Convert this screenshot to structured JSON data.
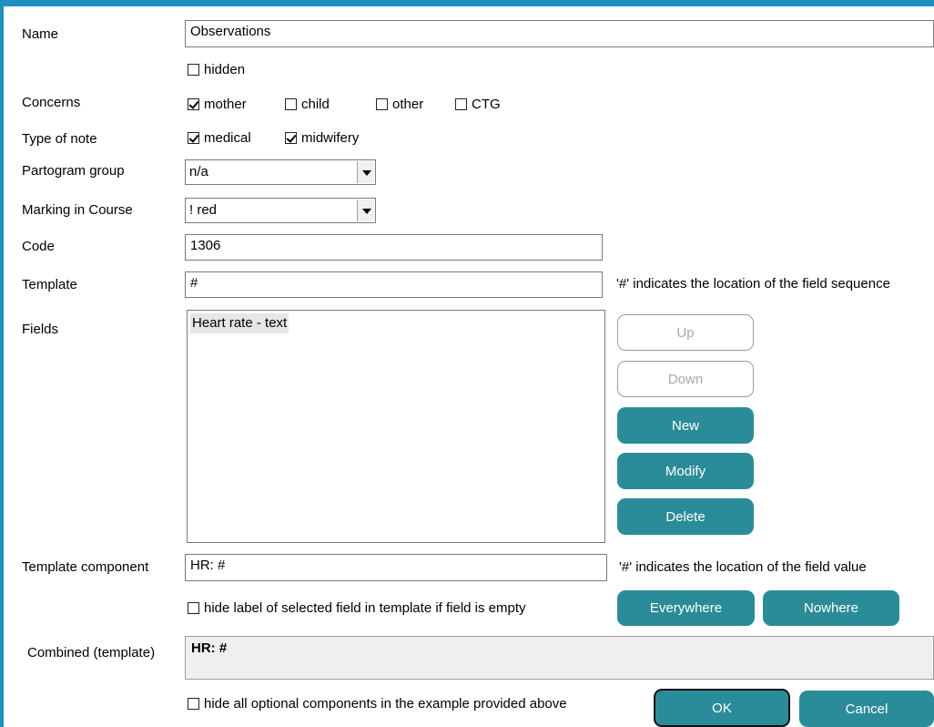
{
  "labels": {
    "name": "Name",
    "concerns": "Concerns",
    "type_of_note": "Type of note",
    "partogram_group": "Partogram group",
    "marking_in_course": "Marking in Course",
    "code": "Code",
    "template": "Template",
    "fields": "Fields",
    "template_component": "Template  component",
    "combined": "Combined (template)"
  },
  "name_value": "Observations",
  "hidden": {
    "label": "hidden",
    "checked": false
  },
  "concerns": [
    {
      "label": "mother",
      "checked": true
    },
    {
      "label": "child",
      "checked": false
    },
    {
      "label": "other",
      "checked": false
    },
    {
      "label": "CTG",
      "checked": false
    }
  ],
  "type_of_note": [
    {
      "label": "medical",
      "checked": true
    },
    {
      "label": "midwifery",
      "checked": true
    }
  ],
  "partogram_group_value": "n/a",
  "marking_value": "! red",
  "code_value": "1306",
  "template_value": "#",
  "template_hint": "'#' indicates the location of the field sequence",
  "fields_list": [
    "Heart rate - text"
  ],
  "buttons": {
    "up": "Up",
    "down": "Down",
    "new": "New",
    "modify": "Modify",
    "delete": "Delete",
    "everywhere": "Everywhere",
    "nowhere": "Nowhere",
    "ok": "OK",
    "cancel": "Cancel"
  },
  "template_component_value": "HR: #",
  "template_component_hint": "'#' indicates the location of the field value",
  "hide_label": {
    "label": "hide label of selected field in template if field is empty",
    "checked": false
  },
  "combined_value": "HR: #",
  "hide_optional": {
    "label": "hide all optional components in the example provided above",
    "checked": false
  },
  "colors": {
    "accent": "#2b8c99",
    "frame": "#1e8fbf"
  }
}
